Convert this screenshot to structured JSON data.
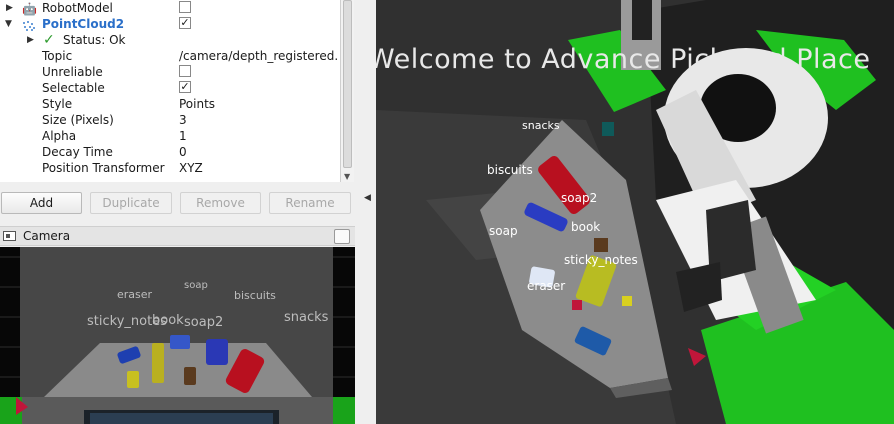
{
  "displays": {
    "robot_model": {
      "label": "RobotModel",
      "checked": false
    },
    "point_cloud": {
      "label": "PointCloud2",
      "checked": true
    },
    "status": {
      "label": "Status: Ok"
    },
    "props": [
      {
        "name": "Topic",
        "value": "/camera/depth_registered."
      },
      {
        "name": "Unreliable",
        "value": "",
        "checkbox": true,
        "checked": false
      },
      {
        "name": "Selectable",
        "value": "",
        "checkbox": true,
        "checked": true
      },
      {
        "name": "Style",
        "value": "Points"
      },
      {
        "name": "Size (Pixels)",
        "value": "3"
      },
      {
        "name": "Alpha",
        "value": "1"
      },
      {
        "name": "Decay Time",
        "value": "0"
      },
      {
        "name": "Position Transformer",
        "value": "XYZ"
      }
    ],
    "check_mark": "✓",
    "icons": {
      "expand": "triangle-right-icon",
      "collapse": "triangle-down-icon",
      "status_ok": "checkmark-icon"
    }
  },
  "buttons": {
    "add": "Add",
    "duplicate": "Duplicate",
    "remove": "Remove",
    "rename": "Rename"
  },
  "camera_panel": {
    "title": "Camera",
    "labels": {
      "eraser": "eraser",
      "soap": "soap",
      "biscuits": "biscuits",
      "sticky_notes": "sticky_notes",
      "book": "book",
      "soap2": "soap2",
      "snacks": "snacks"
    }
  },
  "scene": {
    "banner": "Welcome  to  Advance  Pick  and  Place",
    "labels": {
      "snacks": "snacks",
      "biscuits": "biscuits",
      "soap2": "soap2",
      "soap": "soap",
      "book": "book",
      "sticky_notes": "sticky_notes",
      "eraser": "eraser"
    },
    "colors": {
      "background": "#303030",
      "table": "#8f8f8f",
      "robot_green": "#1fc020"
    }
  }
}
